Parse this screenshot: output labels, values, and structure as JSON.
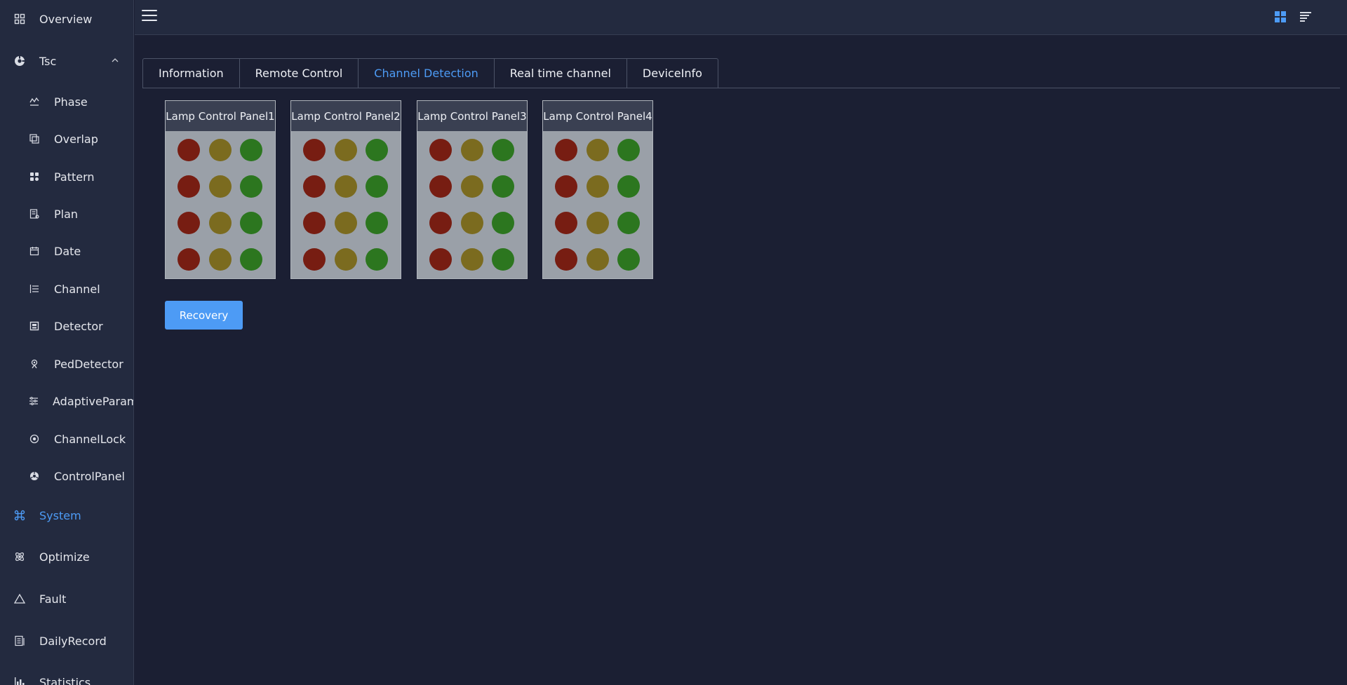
{
  "sidebar": {
    "items": [
      {
        "name": "sidebar-item-overview",
        "icon": "grid-icon",
        "label": "Overview",
        "level": "top"
      },
      {
        "name": "sidebar-item-tsc",
        "icon": "tsc-icon",
        "label": "Tsc",
        "level": "top",
        "expanded": true
      },
      {
        "name": "sidebar-item-phase",
        "icon": "phase-icon",
        "label": "Phase",
        "level": "sub"
      },
      {
        "name": "sidebar-item-overlap",
        "icon": "overlap-icon",
        "label": "Overlap",
        "level": "sub"
      },
      {
        "name": "sidebar-item-pattern",
        "icon": "pattern-icon",
        "label": "Pattern",
        "level": "sub"
      },
      {
        "name": "sidebar-item-plan",
        "icon": "plan-icon",
        "label": "Plan",
        "level": "sub"
      },
      {
        "name": "sidebar-item-date",
        "icon": "calendar-icon",
        "label": "Date",
        "level": "sub"
      },
      {
        "name": "sidebar-item-channel",
        "icon": "list-icon",
        "label": "Channel",
        "level": "sub"
      },
      {
        "name": "sidebar-item-detector",
        "icon": "detector-icon",
        "label": "Detector",
        "level": "sub"
      },
      {
        "name": "sidebar-item-peddetector",
        "icon": "pedestrian-icon",
        "label": "PedDetector",
        "level": "sub"
      },
      {
        "name": "sidebar-item-adaptiveparameter",
        "icon": "sliders-icon",
        "label": "AdaptiveParameter",
        "level": "sub"
      },
      {
        "name": "sidebar-item-channellock",
        "icon": "lock-circle-icon",
        "label": "ChannelLock",
        "level": "sub"
      },
      {
        "name": "sidebar-item-controlpanel",
        "icon": "control-panel-icon",
        "label": "ControlPanel",
        "level": "sub"
      },
      {
        "name": "sidebar-item-system",
        "icon": "command-icon",
        "label": "System",
        "level": "top",
        "active": true
      },
      {
        "name": "sidebar-item-optimize",
        "icon": "atom-icon",
        "label": "Optimize",
        "level": "top"
      },
      {
        "name": "sidebar-item-fault",
        "icon": "warning-icon",
        "label": "Fault",
        "level": "top"
      },
      {
        "name": "sidebar-item-dailyrecord",
        "icon": "record-icon",
        "label": "DailyRecord",
        "level": "top"
      },
      {
        "name": "sidebar-item-statistics",
        "icon": "bar-chart-icon",
        "label": "Statistics",
        "level": "top"
      }
    ]
  },
  "header": {
    "menu_icon": "hamburger-icon",
    "right_icons": [
      "dashboard-icon",
      "sort-icon"
    ]
  },
  "tabs": [
    {
      "label": "Information",
      "active": false
    },
    {
      "label": "Remote Control",
      "active": false
    },
    {
      "label": "Channel Detection",
      "active": true
    },
    {
      "label": "Real time channel",
      "active": false
    },
    {
      "label": "DeviceInfo",
      "active": false
    }
  ],
  "panels": [
    {
      "title": "Lamp Control Panel1"
    },
    {
      "title": "Lamp Control Panel2"
    },
    {
      "title": "Lamp Control Panel3"
    },
    {
      "title": "Lamp Control Panel4"
    }
  ],
  "lamp_rows": 4,
  "lamp_colors": {
    "red": "#771d12",
    "yellow": "#7b6b1f",
    "green": "#2c761f"
  },
  "colors": {
    "accent": "#4d9bf5",
    "background": "#1b1f33",
    "sidebar": "#232a3f"
  },
  "actions": {
    "recovery_label": "Recovery"
  }
}
